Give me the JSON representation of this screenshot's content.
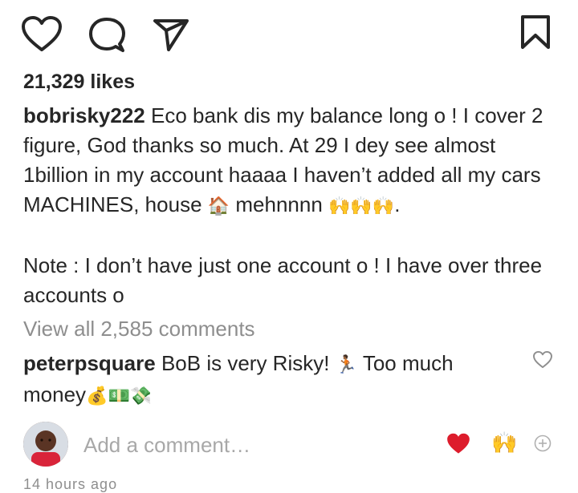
{
  "post": {
    "likes": "21,329 likes",
    "caption_user": "bobrisky222",
    "caption_text": " Eco bank dis my balance long o ! I cover 2 figure, God thanks so much. At 29 I dey see almost 1billion in my account haaaa I haven’t added all my cars MACHINES, house ",
    "caption_house_emoji": "🏠",
    "caption_text2": " mehnnnn ",
    "caption_hands_emoji": "🙌🙌🙌",
    "caption_end": ".",
    "note_text": "Note : I don’t have just one account o ! I have over three accounts o",
    "view_all_comments": "View all 2,585 comments",
    "comment": {
      "user": "peterpsquare",
      "text": " BoB is very Risky! ",
      "runner_emoji": "🏃🏾",
      "text2": " Too much money",
      "money_emojis": "💰💵💸"
    },
    "add_comment_placeholder": "Add a comment…",
    "reaction_heart": "❤️",
    "reaction_hands": "🙌",
    "timestamp": "14 hours ago"
  },
  "icons": [
    "heart-icon",
    "comment-icon",
    "share-icon",
    "bookmark-icon",
    "plus-circle-icon"
  ],
  "colors": {
    "text": "#262626",
    "muted": "#8e8e8e",
    "heart_red": "#e0245e"
  }
}
